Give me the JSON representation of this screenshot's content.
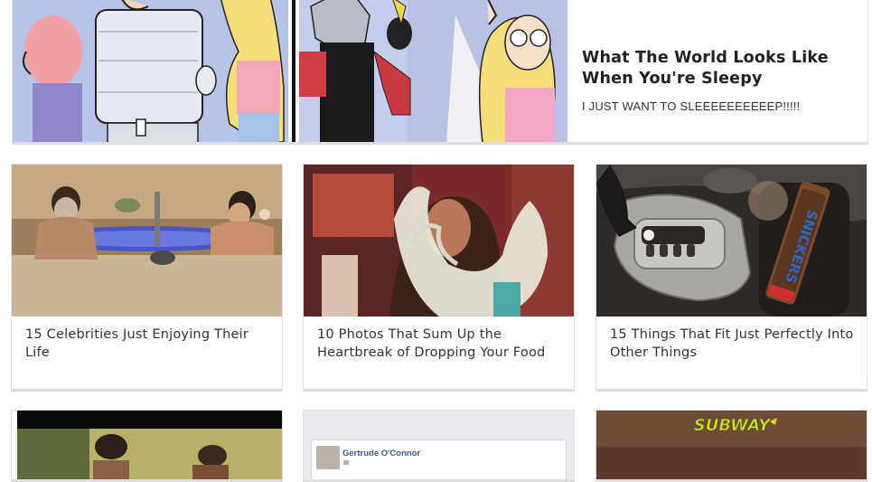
{
  "featured": {
    "title": "What The World Looks Like When You're Sleepy",
    "subtitle": "I JUST WANT TO SLEEEEEEEEEEP!!!!!"
  },
  "cards": [
    {
      "title": "15 Celebrities Just Enjoying Their Life"
    },
    {
      "title": "10 Photos That Sum Up the Heartbreak of Dropping Your Food"
    },
    {
      "title": "15 Things That Fit Just Perfectly Into Other Things"
    }
  ],
  "row3": {
    "fb_name": "Gertrude O'Connor",
    "logo_text": "SUBWAY",
    "candy_text": "SNICKERS"
  },
  "colors": {
    "card_border": "#e1e1e1",
    "title": "#333333",
    "subway_yellow": "#f2d21a"
  }
}
